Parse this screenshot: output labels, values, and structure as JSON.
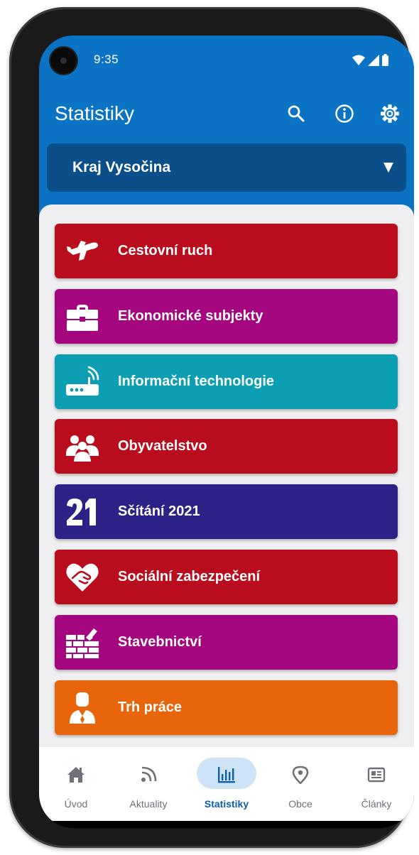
{
  "status_bar": {
    "time": "9:35"
  },
  "app_bar": {
    "title": "Statistiky",
    "region": "Kraj Vysočina"
  },
  "categories": [
    {
      "label": "Cestovní ruch",
      "color": "#b90d1e",
      "icon": "airplane-icon"
    },
    {
      "label": "Ekonomické subjekty",
      "color": "#a5067f",
      "icon": "briefcase-icon"
    },
    {
      "label": "Informační technologie",
      "color": "#0c9fb4",
      "icon": "router-icon"
    },
    {
      "label": "Obyvatelstvo",
      "color": "#b90d1e",
      "icon": "people-icon"
    },
    {
      "label": "Sčítání 2021",
      "color": "#2b2186",
      "icon": "census-21-icon"
    },
    {
      "label": "Sociální zabezpečení",
      "color": "#b90d1e",
      "icon": "heart-hand-icon"
    },
    {
      "label": "Stavebnictví",
      "color": "#a5067f",
      "icon": "brick-wall-icon"
    },
    {
      "label": "Trh práce",
      "color": "#e9650c",
      "icon": "worker-icon"
    }
  ],
  "nav": [
    {
      "label": "Úvod",
      "icon": "home-icon",
      "active": false
    },
    {
      "label": "Aktuality",
      "icon": "rss-icon",
      "active": false
    },
    {
      "label": "Statistiky",
      "icon": "bar-chart-icon",
      "active": true
    },
    {
      "label": "Obce",
      "icon": "map-pin-icon",
      "active": false
    },
    {
      "label": "Články",
      "icon": "newspaper-icon",
      "active": false
    }
  ],
  "colors": {
    "app_bar": "#0a73c4",
    "region_select": "#0a4f8a",
    "nav_active": "#0a5fa8"
  }
}
